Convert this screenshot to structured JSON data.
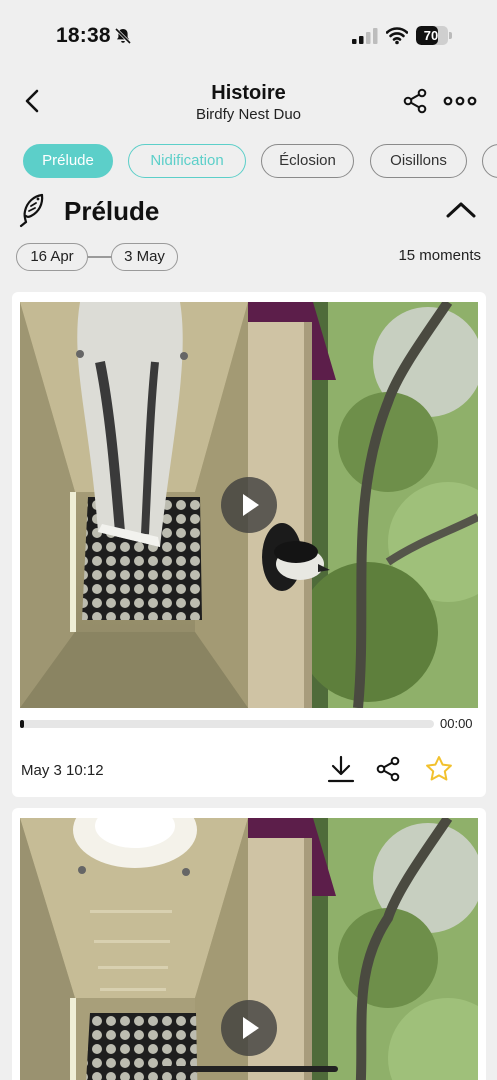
{
  "status_bar": {
    "time": "18:38",
    "battery": "70",
    "battery_level": 0.7
  },
  "header": {
    "title": "Histoire",
    "subtitle": "Birdfy Nest Duo"
  },
  "tabs": [
    {
      "label": "Prélude",
      "state": "active"
    },
    {
      "label": "Nidification",
      "state": "highlighted"
    },
    {
      "label": "Éclosion",
      "state": "default"
    },
    {
      "label": "Oisillons",
      "state": "default"
    },
    {
      "label": "",
      "state": "default"
    }
  ],
  "section": {
    "title": "Prélude"
  },
  "date_range": {
    "start": "16 Apr",
    "end": "3 May",
    "moments": "15 moments"
  },
  "moments": [
    {
      "date": "May 3 10:12",
      "duration": "00:00",
      "progress": 0.01,
      "favorite": false
    },
    {
      "date": "",
      "duration": "",
      "progress": 0,
      "favorite": false
    }
  ],
  "colors": {
    "accent": "#5ccfc9",
    "background": "#efefef",
    "star": "#f2c12e"
  },
  "icons": [
    "back-icon",
    "share-icon",
    "more-icon",
    "bird-icon",
    "chevron-up-icon",
    "play-icon",
    "download-icon",
    "star-icon",
    "bell-slash-icon",
    "signal-icon",
    "wifi-icon"
  ]
}
